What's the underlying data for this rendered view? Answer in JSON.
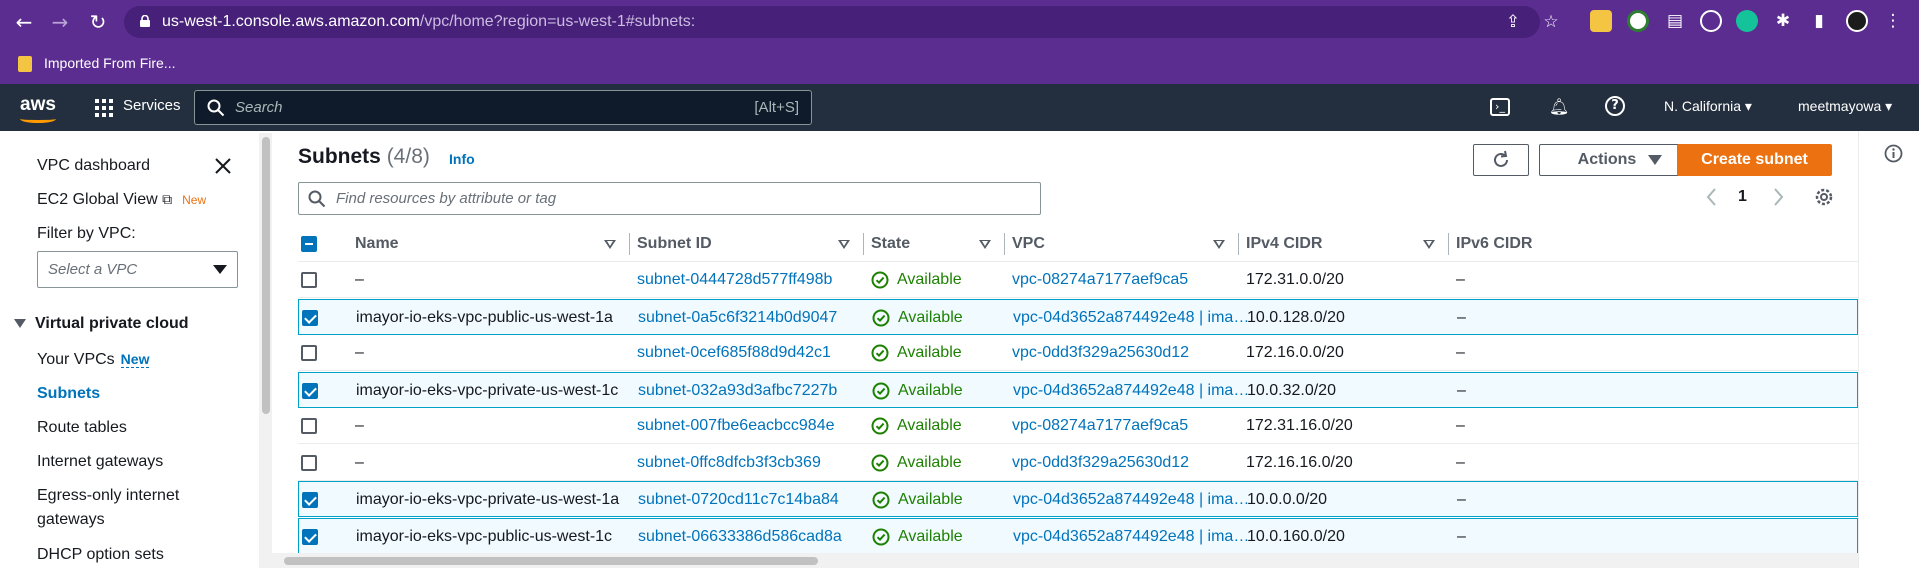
{
  "browser": {
    "url_host": "us-west-1.console.aws.amazon.com",
    "url_path": "/vpc/home?region=us-west-1#subnets:",
    "bookmark_label": "Imported From Fire..."
  },
  "aws_header": {
    "logo": "aws",
    "services_label": "Services",
    "search_placeholder": "Search",
    "search_shortcut": "[Alt+S]",
    "region": "N. California",
    "account": "meetmayowa"
  },
  "sidenav": {
    "dashboard": "VPC dashboard",
    "ec2_global_view": "EC2 Global View",
    "new_badge": "New",
    "filter_label": "Filter by VPC:",
    "filter_placeholder": "Select a VPC",
    "section_title": "Virtual private cloud",
    "items": [
      {
        "label": "Your VPCs",
        "badge": "New"
      },
      {
        "label": "Subnets"
      },
      {
        "label": "Route tables"
      },
      {
        "label": "Internet gateways"
      },
      {
        "label": "Egress-only internet"
      },
      {
        "label": "gateways"
      },
      {
        "label": "DHCP option sets"
      }
    ]
  },
  "main": {
    "title": "Subnets",
    "count": "(4/8)",
    "info_link": "Info",
    "actions_label": "Actions",
    "create_label": "Create subnet",
    "find_placeholder": "Find resources by attribute or tag",
    "page_number": "1"
  },
  "table": {
    "columns": [
      "Name",
      "Subnet ID",
      "State",
      "VPC",
      "IPv4 CIDR",
      "IPv6 CIDR"
    ],
    "rows": [
      {
        "selected": false,
        "name": "–",
        "subnet_id": "subnet-0444728d577ff498b",
        "state": "Available",
        "vpc": "vpc-08274a7177aef9ca5",
        "ipv4": "172.31.0.0/20",
        "ipv6": "–"
      },
      {
        "selected": true,
        "name": "imayor-io-eks-vpc-public-us-west-1a",
        "subnet_id": "subnet-0a5c6f3214b0d9047",
        "state": "Available",
        "vpc": "vpc-04d3652a874492e48 | ima…",
        "ipv4": "10.0.128.0/20",
        "ipv6": "–"
      },
      {
        "selected": false,
        "name": "–",
        "subnet_id": "subnet-0cef685f88d9d42c1",
        "state": "Available",
        "vpc": "vpc-0dd3f329a25630d12",
        "ipv4": "172.16.0.0/20",
        "ipv6": "–"
      },
      {
        "selected": true,
        "name": "imayor-io-eks-vpc-private-us-west-1c",
        "subnet_id": "subnet-032a93d3afbc7227b",
        "state": "Available",
        "vpc": "vpc-04d3652a874492e48 | ima…",
        "ipv4": "10.0.32.0/20",
        "ipv6": "–"
      },
      {
        "selected": false,
        "name": "–",
        "subnet_id": "subnet-007fbe6eacbcc984e",
        "state": "Available",
        "vpc": "vpc-08274a7177aef9ca5",
        "ipv4": "172.31.16.0/20",
        "ipv6": "–"
      },
      {
        "selected": false,
        "name": "–",
        "subnet_id": "subnet-0ffc8dfcb3f3cb369",
        "state": "Available",
        "vpc": "vpc-0dd3f329a25630d12",
        "ipv4": "172.16.16.0/20",
        "ipv6": "–"
      },
      {
        "selected": true,
        "name": "imayor-io-eks-vpc-private-us-west-1a",
        "subnet_id": "subnet-0720cd11c7c14ba84",
        "state": "Available",
        "vpc": "vpc-04d3652a874492e48 | ima…",
        "ipv4": "10.0.0.0/20",
        "ipv6": "–"
      },
      {
        "selected": true,
        "name": "imayor-io-eks-vpc-public-us-west-1c",
        "subnet_id": "subnet-06633386d586cad8a",
        "state": "Available",
        "vpc": "vpc-04d3652a874492e48 | ima…",
        "ipv4": "10.0.160.0/20",
        "ipv6": "–"
      }
    ]
  },
  "colors": {
    "browser_purple": "#5c2d91",
    "aws_header": "#232f3e",
    "link_blue": "#0073bb",
    "primary_orange": "#ec7211",
    "available_green": "#1d8102"
  }
}
